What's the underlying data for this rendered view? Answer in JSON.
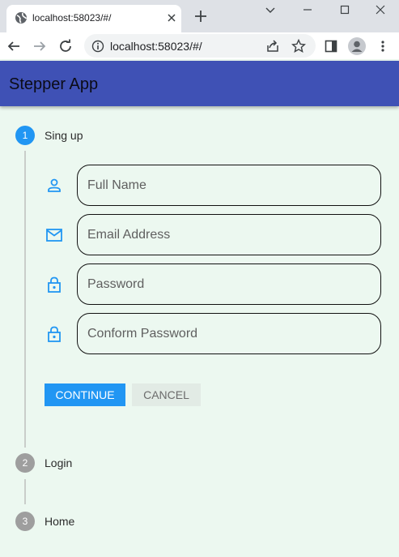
{
  "browser": {
    "tab_title": "localhost:58023/#/",
    "url": "localhost:58023/#/"
  },
  "appbar": {
    "title": "Stepper App",
    "color": "#3f51b5"
  },
  "stepper": {
    "steps": [
      {
        "number": "1",
        "label": "Sing up",
        "state": "active"
      },
      {
        "number": "2",
        "label": "Login",
        "state": "inactive"
      },
      {
        "number": "3",
        "label": "Home",
        "state": "inactive"
      }
    ],
    "active_color": "#2196f3",
    "inactive_color": "#9e9e9e"
  },
  "form": {
    "fields": [
      {
        "icon": "person-icon",
        "placeholder": "Full Name",
        "value": ""
      },
      {
        "icon": "email-icon",
        "placeholder": "Email Address",
        "value": ""
      },
      {
        "icon": "lock-icon",
        "placeholder": "Password",
        "value": ""
      },
      {
        "icon": "lock-icon",
        "placeholder": "Conform Password",
        "value": ""
      }
    ],
    "continue_label": "CONTINUE",
    "cancel_label": "CANCEL"
  }
}
